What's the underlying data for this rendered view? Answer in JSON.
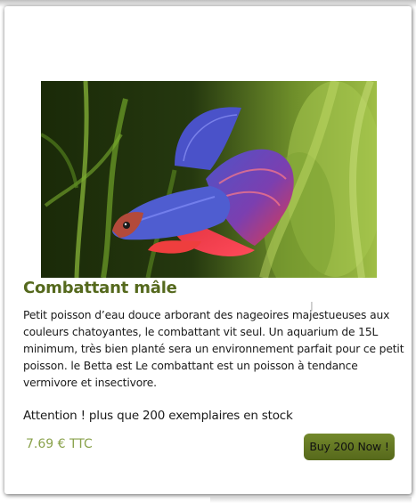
{
  "product": {
    "title": "Combattant mâle",
    "image_subject": "red and blue betta fish among green aquatic plants",
    "description": "Petit poisson d’eau douce arborant des nageoires majestueuses aux couleurs chatoyantes, le combattant vit seul. Un aquarium de 15L minimum, très bien planté sera un environnement parfait pour ce petit poisson. le Betta est Le combattant est un poisson à tendance vermivore et insectivore.",
    "stock_notice": "Attention ! plus que 200 exemplaires en stock",
    "price": "7.69 € TTC",
    "buy_label": "Buy 200 Now !"
  },
  "colors": {
    "title": "#55691d",
    "price": "#8aa24c",
    "button": "#667c25"
  },
  "icons": {
    "cursor": "text-cursor-icon"
  }
}
